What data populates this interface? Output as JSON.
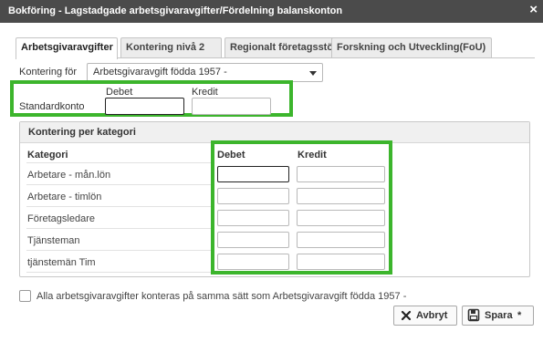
{
  "window": {
    "title": "Bokföring - Lagstadgade arbetsgivaravgifter/Fördelning balanskonton",
    "close_glyph": "×"
  },
  "tabs": [
    {
      "label": "Arbetsgivaravgifter",
      "active": true
    },
    {
      "label": "Kontering nivå 2",
      "active": false
    },
    {
      "label": "Regionalt företagsstöd",
      "active": false
    },
    {
      "label": "Forskning och Utveckling(FoU)",
      "active": false
    }
  ],
  "kontering_for": {
    "label": "Kontering för",
    "selected": "Arbetsgivaravgift födda 1957 -"
  },
  "standardkonto": {
    "label": "Standardkonto",
    "debet_label": "Debet",
    "kredit_label": "Kredit",
    "debet_value": "",
    "kredit_value": ""
  },
  "kategori_panel": {
    "title": "Kontering per kategori",
    "headers": {
      "kategori": "Kategori",
      "debet": "Debet",
      "kredit": "Kredit"
    },
    "rows": [
      {
        "kategori": "Arbetare - mån.lön",
        "debet": "",
        "kredit": ""
      },
      {
        "kategori": "Arbetare - timlön",
        "debet": "",
        "kredit": ""
      },
      {
        "kategori": "Företagsledare",
        "debet": "",
        "kredit": ""
      },
      {
        "kategori": "Tjänsteman",
        "debet": "",
        "kredit": ""
      },
      {
        "kategori": "tjänstemän Tim",
        "debet": "",
        "kredit": ""
      }
    ]
  },
  "same_checkbox": {
    "label": "Alla arbetsgivaravgifter konteras på samma sätt som Arbetsgivaravgift födda 1957 -",
    "checked": false
  },
  "buttons": {
    "cancel_label": "Avbryt",
    "save_label": "Spara",
    "save_marker": "*"
  },
  "colors": {
    "titlebar": "#4b4b4b",
    "highlight": "#3cb52c"
  },
  "icons": {
    "close": "close-icon",
    "dropdown": "chevron-down-icon",
    "cancel": "x-icon",
    "save": "floppy-disk-icon"
  }
}
